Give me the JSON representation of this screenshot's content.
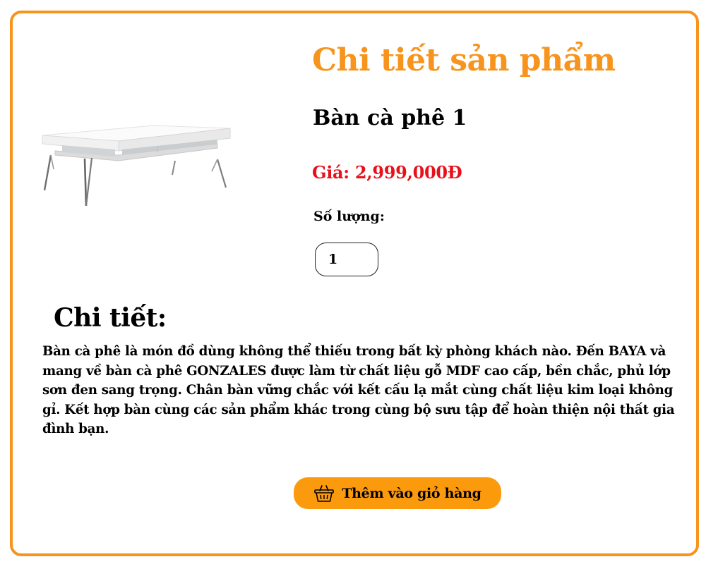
{
  "header": {
    "title": "Chi tiết sản phẩm"
  },
  "product": {
    "name": "Bàn cà phê 1",
    "price": "Giá: 2,999,000Đ",
    "image_icon": "coffee-table-image"
  },
  "quantity": {
    "label": "Số lượng:",
    "value": "1"
  },
  "details": {
    "heading": "Chi tiết:",
    "text": "Bàn cà phê là món đồ dùng không thể thiếu trong bất kỳ phòng khách nào. Đến BAYA và mang về bàn cà phê GONZALES được làm từ chất liệu gỗ MDF cao cấp, bền chắc, phủ lớp sơn đen sang trọng. Chân bàn vững chắc với kết cấu lạ mắt cùng chất liệu kim loại không gỉ. Kết hợp bàn cùng các sản phẩm khác trong cùng bộ sưu tập để hoàn thiện nội thất gia đình bạn."
  },
  "actions": {
    "add_to_cart_label": "Thêm vào giỏ hàng",
    "add_to_cart_icon": "shopping-basket-icon"
  },
  "colors": {
    "accent": "#f7941d",
    "button": "#fc9a0e",
    "price": "#e8101a"
  }
}
